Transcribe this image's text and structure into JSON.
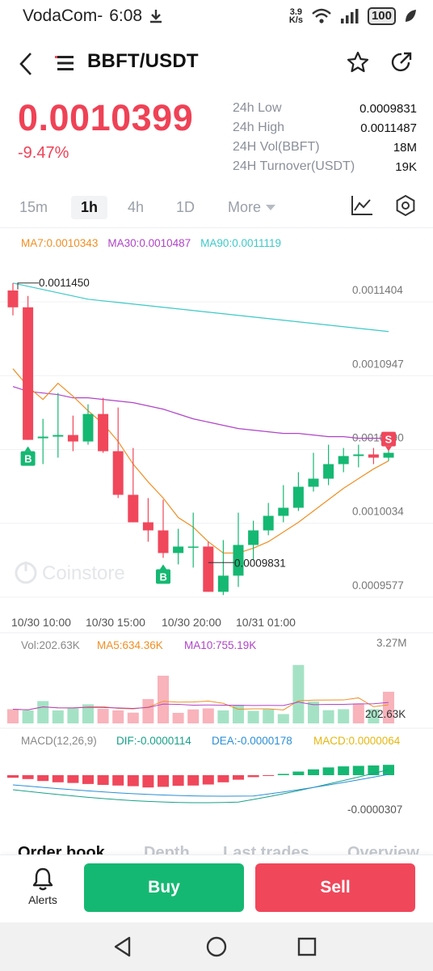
{
  "status_bar": {
    "carrier": "VodaCom-",
    "time": "6:08",
    "net_speed_value": "3.9",
    "net_speed_unit": "K/s",
    "battery": "100",
    "icons": [
      "download-icon",
      "wifi-icon",
      "signal-icon",
      "battery-icon",
      "leaf-icon"
    ]
  },
  "header": {
    "pair": "BBFT/USDT",
    "icons": [
      "back-icon",
      "menu-icon",
      "star-icon",
      "share-icon"
    ]
  },
  "price": {
    "last": "0.0010399",
    "change": "-9.47%",
    "color": "#ef4256"
  },
  "stats": [
    {
      "label": "24h Low",
      "value": "0.0009831"
    },
    {
      "label": "24h High",
      "value": "0.0011487"
    },
    {
      "label": "24H Vol(BBFT)",
      "value": "18M"
    },
    {
      "label": "24H Turnover(USDT)",
      "value": "19K"
    }
  ],
  "timeframes": {
    "items": [
      "15m",
      "1h",
      "4h",
      "1D",
      "More"
    ],
    "active": "1h"
  },
  "ma_legend": {
    "ma7": "MA7:0.0010343",
    "ma30": "MA30:0.0010487",
    "ma90": "MA90:0.0011119",
    "ma7_color": "#ef8f24",
    "ma30_color": "#b044c7",
    "ma90_color": "#3ec8c8"
  },
  "watermark": "Coinstore",
  "chart_data": {
    "type": "candlestick",
    "up_color": "#15b872",
    "down_color": "#f0475b",
    "y_ticks": [
      "0.0011404",
      "0.0010947",
      "0.0010490",
      "0.0010034",
      "0.0009577"
    ],
    "y_tick_values": [
      0.0011404,
      0.0010947,
      0.001049,
      0.0010034,
      0.0009577
    ],
    "x_ticks": [
      "10/30 10:00",
      "10/30 15:00",
      "10/30 20:00",
      "10/31 01:00"
    ],
    "high_label": "0.0011450",
    "low_label": "0.0009831",
    "candles": [
      {
        "o": 0.0011404,
        "h": 0.001145,
        "l": 0.001125,
        "c": 0.00113
      },
      {
        "o": 0.00113,
        "h": 0.001137,
        "l": 0.001048,
        "c": 0.001048
      },
      {
        "o": 0.001049,
        "h": 0.001061,
        "l": 0.001033,
        "c": 0.00105
      },
      {
        "o": 0.00105,
        "h": 0.001077,
        "l": 0.001037,
        "c": 0.001051
      },
      {
        "o": 0.001051,
        "h": 0.001063,
        "l": 0.001041,
        "c": 0.001047
      },
      {
        "o": 0.001047,
        "h": 0.00107,
        "l": 0.001045,
        "c": 0.001064
      },
      {
        "o": 0.001064,
        "h": 0.001074,
        "l": 0.00104,
        "c": 0.001041
      },
      {
        "o": 0.001041,
        "h": 0.001068,
        "l": 0.001012,
        "c": 0.001014
      },
      {
        "o": 0.001014,
        "h": 0.001043,
        "l": 0.000997,
        "c": 0.000997
      },
      {
        "o": 0.000997,
        "h": 0.001012,
        "l": 0.000985,
        "c": 0.000992
      },
      {
        "o": 0.000992,
        "h": 0.001011,
        "l": 0.000975,
        "c": 0.000978
      },
      {
        "o": 0.000978,
        "h": 0.000993,
        "l": 0.000971,
        "c": 0.000982
      },
      {
        "o": 0.000982,
        "h": 0.001003,
        "l": 0.000969,
        "c": 0.000982
      },
      {
        "o": 0.000982,
        "h": 0.000985,
        "l": 0.000954,
        "c": 0.000954
      },
      {
        "o": 0.000954,
        "h": 0.000986,
        "l": 0.000952,
        "c": 0.000964
      },
      {
        "o": 0.000964,
        "h": 0.001003,
        "l": 0.000957,
        "c": 0.000983
      },
      {
        "o": 0.000983,
        "h": 0.000998,
        "l": 0.000974,
        "c": 0.000992
      },
      {
        "o": 0.000992,
        "h": 0.001009,
        "l": 0.000989,
        "c": 0.001001
      },
      {
        "o": 0.001001,
        "h": 0.00102,
        "l": 0.000997,
        "c": 0.001006
      },
      {
        "o": 0.001006,
        "h": 0.001028,
        "l": 0.001004,
        "c": 0.001019
      },
      {
        "o": 0.001019,
        "h": 0.00104,
        "l": 0.001016,
        "c": 0.001024
      },
      {
        "o": 0.001024,
        "h": 0.001045,
        "l": 0.00102,
        "c": 0.001033
      },
      {
        "o": 0.001033,
        "h": 0.001043,
        "l": 0.001028,
        "c": 0.001038
      },
      {
        "o": 0.001038,
        "h": 0.001045,
        "l": 0.001031,
        "c": 0.001039
      },
      {
        "o": 0.001039,
        "h": 0.001043,
        "l": 0.001033,
        "c": 0.001037
      },
      {
        "o": 0.001037,
        "h": 0.001042,
        "l": 0.001035,
        "c": 0.00104
      }
    ],
    "markers": [
      {
        "candle": 1,
        "label": "B",
        "color": "#15b872"
      },
      {
        "candle": 10,
        "label": "B",
        "color": "#15b872"
      },
      {
        "candle": 25,
        "label": "S",
        "color": "#f0475b"
      }
    ],
    "ma7": [
      0.001092,
      0.001081,
      0.001073,
      0.001083,
      0.001075,
      0.001066,
      0.001058,
      0.001047,
      0.001033,
      0.001022,
      0.001012,
      0.001,
      0.000994,
      0.000985,
      0.000978,
      0.000978,
      0.000981,
      0.000985,
      0.000991,
      0.000997,
      0.001004,
      0.001011,
      0.001018,
      0.001024,
      0.00103,
      0.001035
    ],
    "ma30": [
      0.001081,
      0.001078,
      0.001077,
      0.001076,
      0.001074,
      0.001074,
      0.001073,
      0.001072,
      0.001071,
      0.001069,
      0.001067,
      0.001064,
      0.001061,
      0.001059,
      0.001057,
      0.001055,
      0.001054,
      0.001053,
      0.001052,
      0.001052,
      0.001051,
      0.00105,
      0.00105,
      0.001049,
      0.001049,
      0.001049
    ],
    "ma90": [
      0.001145,
      0.001143,
      0.001141,
      0.001139,
      0.001137,
      0.001135,
      0.001134,
      0.001133,
      0.001132,
      0.001131,
      0.00113,
      0.001129,
      0.001128,
      0.001127,
      0.001126,
      0.001125,
      0.001124,
      0.001123,
      0.001122,
      0.001121,
      0.00112,
      0.001119,
      0.001118,
      0.001117,
      0.001116,
      0.001115
    ]
  },
  "volume": {
    "vol_label": "Vol:202.63K",
    "ma5_label": "MA5:634.36K",
    "ma10_label": "MA10:755.19K",
    "max_label": "3.27M",
    "last_label": "202.63K",
    "max_value": 3270000,
    "bars": [
      700000,
      640000,
      1100000,
      640000,
      740000,
      940000,
      720000,
      640000,
      530000,
      1200000,
      2350000,
      520000,
      690000,
      740000,
      640000,
      910000,
      620000,
      690000,
      460000,
      2880000,
      1080000,
      650000,
      700000,
      980000,
      700000,
      1560000
    ],
    "bars_up": [
      false,
      true,
      true,
      true,
      true,
      true,
      false,
      false,
      false,
      false,
      false,
      false,
      false,
      false,
      true,
      true,
      true,
      true,
      true,
      true,
      true,
      true,
      true,
      false,
      true,
      false
    ]
  },
  "macd": {
    "title": "MACD(12,26,9)",
    "dif_label": "DIF:-0.0000114",
    "dea_label": "DEA:-0.0000178",
    "macd_label": "MACD:0.0000064",
    "axis_label": "-0.0000307",
    "dif_color": "#19a189",
    "dea_color": "#2a8fd6",
    "macd_color": "#e5b711",
    "hist": [
      -0.2,
      -0.3,
      -0.45,
      -0.55,
      -0.6,
      -0.68,
      -0.75,
      -0.8,
      -0.85,
      -0.95,
      -0.9,
      -0.82,
      -0.8,
      -0.72,
      -0.55,
      -0.35,
      -0.15,
      -0.05,
      0.1,
      0.28,
      0.45,
      0.6,
      0.68,
      0.72,
      0.75,
      0.8
    ]
  },
  "bottom_tabs": [
    "Order book",
    "Depth",
    "Last trades",
    "Overview"
  ],
  "actions": {
    "alerts": "Alerts",
    "buy": "Buy",
    "sell": "Sell"
  },
  "navbar": [
    "back-nav-icon",
    "home-nav-icon",
    "recents-nav-icon"
  ]
}
